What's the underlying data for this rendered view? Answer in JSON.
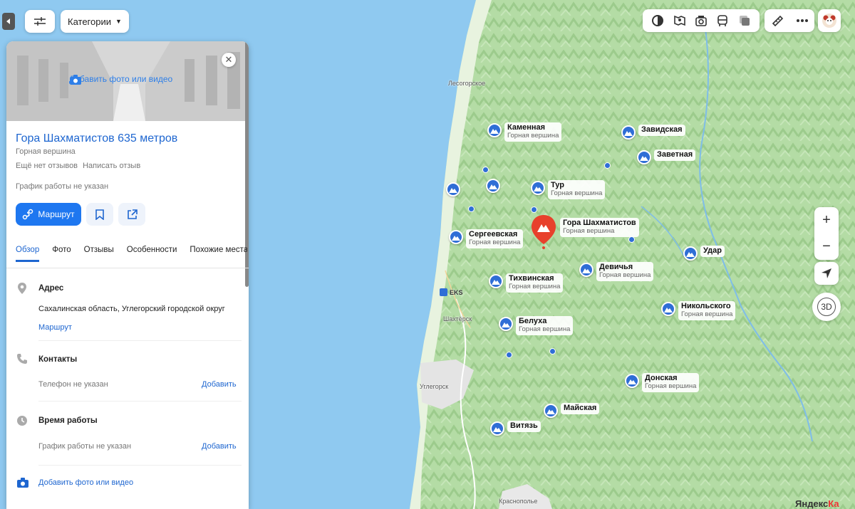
{
  "top_controls": {
    "categories_label": "Категории"
  },
  "panel": {
    "add_photo_top": "Добавить фото или видео",
    "title": "Гора Шахматистов 635 метров",
    "subtitle": "Горная вершина",
    "no_reviews": "Ещё нет отзывов",
    "write_review": "Написать отзыв",
    "hours_not_set": "График работы не указан",
    "route_button": "Маршрут",
    "tabs": [
      "Обзор",
      "Фото",
      "Отзывы",
      "Особенности",
      "Похожие места"
    ],
    "address": {
      "title": "Адрес",
      "value": "Сахалинская область, Углегорский городской округ",
      "route_link": "Маршрут"
    },
    "contacts": {
      "title": "Контакты",
      "phone": "Телефон не указан",
      "add": "Добавить"
    },
    "hours": {
      "title": "Время работы",
      "value": "График работы не указан",
      "add": "Добавить"
    },
    "add_photo_bottom": "Добавить фото или видео"
  },
  "map": {
    "places": [
      "Лесогорское",
      "Шахтёрск",
      "Углегорск",
      "Краснополье"
    ],
    "station": "EKS",
    "peak_type": "Горная вершина",
    "peaks": [
      {
        "name": "Каменная",
        "show_type": true
      },
      {
        "name": "Завидская",
        "show_type": false
      },
      {
        "name": "Заветная",
        "show_type": false
      },
      {
        "name": "Тур",
        "show_type": true
      },
      {
        "name": "Сергеевская",
        "show_type": true
      },
      {
        "name": "Удар",
        "show_type": false
      },
      {
        "name": "Девичья",
        "show_type": true
      },
      {
        "name": "Тихвинская",
        "show_type": true
      },
      {
        "name": "Никольского",
        "show_type": true
      },
      {
        "name": "Белуха",
        "show_type": true
      },
      {
        "name": "Донская",
        "show_type": true
      },
      {
        "name": "Майская",
        "show_type": false
      },
      {
        "name": "Витязь",
        "show_type": false
      }
    ],
    "selected": {
      "name": "Гора Шахматистов",
      "type": "Горная вершина"
    }
  },
  "right_controls": {
    "zoom_in": "+",
    "zoom_out": "−",
    "three_d": "3D"
  },
  "brand": {
    "name": "Яндекс",
    "suffix": "Ка"
  },
  "colors": {
    "water": "#8fc9f0",
    "land": "#cfe9c4",
    "forest": "#a9d69a",
    "accent": "#1e77f0",
    "pin": "#e8412c",
    "peak_marker": "#2f6ed6"
  },
  "icons": [
    "filter-icon",
    "camera-icon",
    "close-icon",
    "route-icon",
    "bookmark-icon",
    "share-icon",
    "location-pin-icon",
    "phone-icon",
    "clock-icon",
    "layers-icon",
    "panorama-icon",
    "photo-icon",
    "transit-icon",
    "traffic-icon",
    "ruler-icon",
    "more-icon",
    "geolocation-icon",
    "mountain-icon"
  ]
}
